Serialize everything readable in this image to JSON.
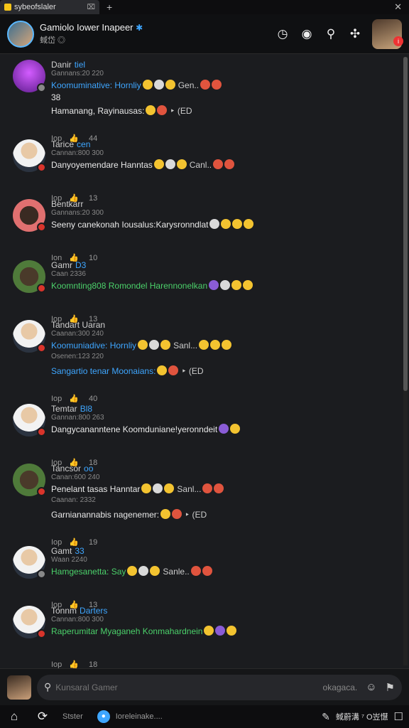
{
  "browser": {
    "tab_title": "sybeofslaler",
    "tab_close": "⌧",
    "new_tab": "+",
    "window_close": "✕"
  },
  "header": {
    "channel_name": "Gamiolo Iower Inapeer",
    "verified_icon": "verified-badge-icon",
    "subtitle": "蜮岱 ◎",
    "icons": [
      "clock-icon",
      "explore-icon",
      "search-icon",
      "puzzle-icon"
    ],
    "profile_badge": "i"
  },
  "comments": [
    {
      "name": "Danir",
      "tag": "tiel",
      "meta": "Gannans:20 220",
      "lines": [
        {
          "text": "Koomuminative: Hornliy",
          "color": "blue",
          "emoji_text": "Gen..",
          "emojis": [
            "y",
            "w",
            "y",
            "r",
            "r"
          ]
        },
        {
          "text": "38",
          "color": "white",
          "emojis": []
        },
        {
          "text": "Hamanang, Rayinausas:",
          "color": "white",
          "emoji_text": "‣ (ED",
          "emojis": [
            "y",
            "r"
          ]
        }
      ],
      "reply": "Iop",
      "count": "44",
      "avatar": "purple"
    },
    {
      "name": "Tarice",
      "tag": "cen",
      "meta": "Cannan:800 300",
      "lines": [
        {
          "text": "Danyoyemendare Hanntas",
          "color": "white",
          "emoji_text": "Canl..",
          "emojis": [
            "y",
            "w",
            "y",
            "r",
            "r"
          ]
        }
      ],
      "reply": "Iop",
      "count": "13",
      "avatar": "person"
    },
    {
      "name": "Bentkarr",
      "tag": "",
      "meta": "Gannans:20 300",
      "lines": [
        {
          "text": "Seeny canekonah Iousalus:Karysronndlat",
          "color": "white",
          "emojis": [
            "w",
            "y",
            "y",
            "y"
          ]
        }
      ],
      "reply": "Ion",
      "count": "10",
      "avatar": "red"
    },
    {
      "name": "Gamr",
      "tag": "D3",
      "meta": "Caan  2336",
      "lines": [
        {
          "text": "Koomnting808 Romondel Harennonelkan",
          "color": "green",
          "emojis": [
            "p",
            "w",
            "y",
            "y"
          ]
        }
      ],
      "reply": "Iop",
      "count": "13",
      "avatar": "green"
    },
    {
      "name": "Tandart Uaran",
      "tag": "",
      "meta": "Caanan:300 240",
      "lines": [
        {
          "text": "Koomuniadive: Hornliy",
          "color": "blue",
          "emoji_text": "Sanl...",
          "emojis": [
            "y",
            "w",
            "y",
            "y",
            "y",
            "y"
          ]
        },
        {
          "text": "Osenen:123 220",
          "color": "gray",
          "emojis": []
        },
        {
          "text": "Sangartio tenar Moonaians:",
          "color": "blue",
          "emoji_text": "‣ (ED",
          "emojis": [
            "y",
            "r"
          ]
        }
      ],
      "reply": "Iop",
      "count": "40",
      "avatar": "person"
    },
    {
      "name": "Temtar",
      "tag": "Bl8",
      "meta": "Gannan:800 263",
      "lines": [
        {
          "text": "Dangycananntene Koomduniane!yeronndeit",
          "color": "white",
          "emojis": [
            "p",
            "y"
          ]
        }
      ],
      "reply": "Iop",
      "count": "18",
      "avatar": "person"
    },
    {
      "name": "Tancsor",
      "tag": "oo",
      "meta": "Canan:600 240",
      "lines": [
        {
          "text": "Penelant tasas Hanntar",
          "color": "white",
          "emoji_text": "Sanl...",
          "emojis": [
            "y",
            "w",
            "y",
            "r",
            "r"
          ]
        },
        {
          "text": "Caanan: 2332",
          "color": "gray",
          "emojis": []
        },
        {
          "text": "Garnianannabis nagenemer:",
          "color": "white",
          "emoji_text": "‣ (ED",
          "emojis": [
            "y",
            "r"
          ]
        }
      ],
      "reply": "Iop",
      "count": "19",
      "avatar": "green"
    },
    {
      "name": "Gamt",
      "tag": "33",
      "meta": "Waan  2240",
      "lines": [
        {
          "text": "Hamgesanetta: Say",
          "color": "green",
          "emoji_text": "Sanle..",
          "emojis": [
            "y",
            "w",
            "y",
            "r",
            "r"
          ]
        }
      ],
      "reply": "Iop",
      "count": "13",
      "avatar": "person"
    },
    {
      "name": "Tonnm",
      "tag": "Darters",
      "meta": "Cannan:800 300",
      "lines": [
        {
          "text": "Raperumitar Myaganeh Konmahardnein",
          "color": "green",
          "emojis": [
            "y",
            "p",
            "y"
          ]
        }
      ],
      "reply": "Iop",
      "count": "18",
      "avatar": "person"
    }
  ],
  "composer": {
    "placeholder": "Kunsaral Gamer",
    "placeholder_suffix": "okagaca.",
    "emoji_icon": "smile-icon",
    "send_icon": "flag-icon"
  },
  "navbar": {
    "home": "⌂",
    "refresh": "⟳",
    "item1": "Stster",
    "item2": "Ioreleinake....",
    "right_text": "蜮蔚溝 ⁷ O岦懳"
  }
}
